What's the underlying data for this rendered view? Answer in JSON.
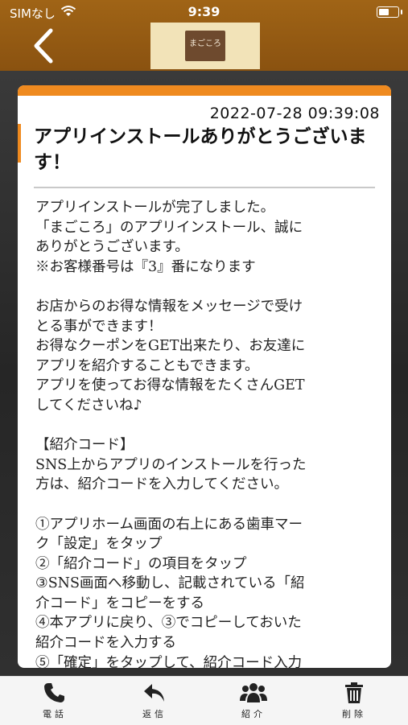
{
  "status_bar": {
    "carrier": "SIMなし",
    "time": "9:39"
  },
  "header": {
    "logo_text": "まごころ"
  },
  "message": {
    "timestamp": "2022-07-28 09:39:08",
    "title": "アプリインストールありがとうございます！",
    "body_lines": [
      "アプリインストールが完了しました。",
      "「まごころ」のアプリインストール、誠に",
      "ありがとうございます。",
      "※お客様番号は『3』番になります",
      "",
      "お店からのお得な情報をメッセージで受け",
      "とる事ができます！",
      "お得なクーポンをGET出来たり、お友達に",
      "アプリを紹介することもできます。",
      "アプリを使ってお得な情報をたくさんGET",
      "してくださいね♪",
      "",
      "【紹介コード】",
      "SNS上からアプリのインストールを行った",
      "方は、紹介コードを入力してください。",
      "",
      "①アプリホーム画面の右上にある歯車マー",
      "ク「設定」をタップ",
      "②「紹介コード」の項目をタップ",
      "③SNS画面へ移動し、記載されている「紹",
      "介コード」をコピーをする",
      "④本アプリに戻り、③でコピーしておいた",
      "紹介コードを入力する",
      "⑤「確定」をタップして、紹介コード入力"
    ]
  },
  "tabs": [
    {
      "label": "電話",
      "icon": "phone-icon"
    },
    {
      "label": "返信",
      "icon": "reply-icon"
    },
    {
      "label": "紹介",
      "icon": "users-icon"
    },
    {
      "label": "削除",
      "icon": "trash-icon"
    }
  ],
  "colors": {
    "header": "#93580f",
    "accent": "#ef8a1f"
  }
}
